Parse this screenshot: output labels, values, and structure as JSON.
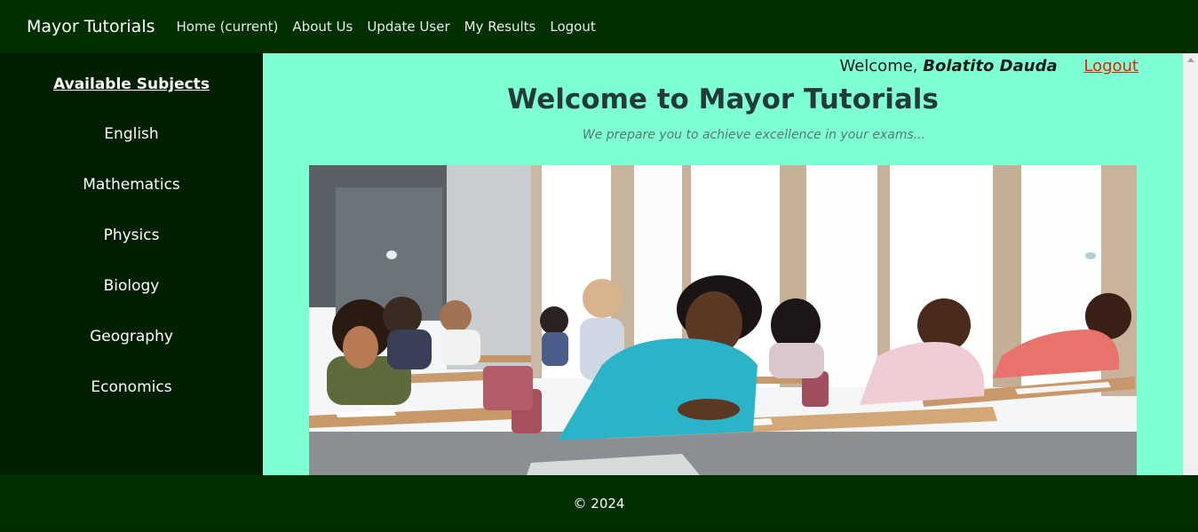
{
  "navbar": {
    "brand": "Mayor Tutorials",
    "links": [
      "Home (current)",
      "About Us",
      "Update User",
      "My Results",
      "Logout"
    ]
  },
  "sidebar": {
    "title": "Available Subjects",
    "subjects": [
      "English",
      "Mathematics",
      "Physics",
      "Biology",
      "Geography",
      "Economics"
    ]
  },
  "main": {
    "welcome_prefix": "Welcome,",
    "user_name": "Bolatito Dauda",
    "logout_label": "Logout",
    "title": "Welcome to Mayor Tutorials",
    "tagline": "We prepare you to achieve excellence in your exams..."
  },
  "footer": {
    "copyright": "© 2024"
  },
  "colors": {
    "navbar_bg": "#002f00",
    "sidebar_bg": "#001f00",
    "main_bg": "#7fffd4",
    "logout_link": "#e32200"
  }
}
